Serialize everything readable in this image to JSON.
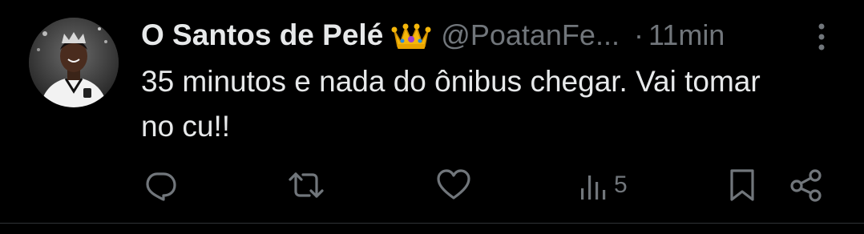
{
  "tweet": {
    "display_name": "O Santos de Pelé",
    "badge_emoji": "crown-emoji",
    "handle": "@PoatanFe...",
    "separator": "·",
    "timestamp": "11min",
    "text": "35 minutos e nada do ônibus chegar. Vai tomar no cu!!",
    "views": "5"
  },
  "icons": {
    "more": "more-vertical-icon",
    "reply": "reply-icon",
    "retweet": "retweet-icon",
    "like": "heart-icon",
    "views": "views-icon",
    "bookmark": "bookmark-icon",
    "share": "share-icon"
  },
  "colors": {
    "background": "#000000",
    "text_primary": "#e7e9ea",
    "text_secondary": "#71767b",
    "divider": "#2f3336"
  }
}
